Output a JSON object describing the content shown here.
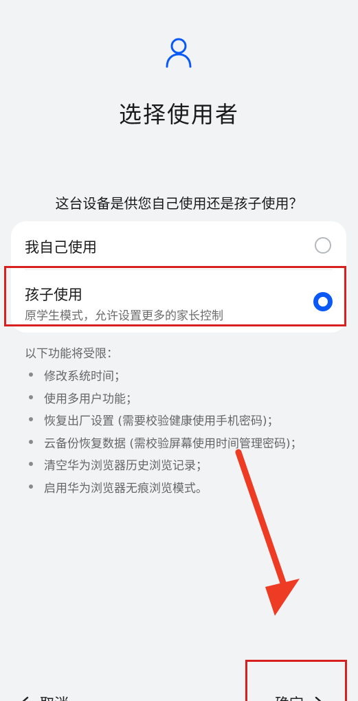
{
  "header": {
    "icon": "user-icon",
    "title": "选择使用者"
  },
  "question": "这台设备是供您自己使用还是孩子使用？",
  "options": {
    "self": {
      "label": "我自己使用",
      "selected": false
    },
    "child": {
      "label": "孩子使用",
      "description": "原学生模式，允许设置更多的家长控制",
      "selected": true
    }
  },
  "restrictions": {
    "title": "以下功能将受限：",
    "items": [
      "修改系统时间；",
      "使用多用户功能；",
      "恢复出厂设置 (需要校验健康使用手机密码)；",
      "云备份恢复数据 (需校验屏幕使用时间管理密码)；",
      "清空华为浏览器历史浏览记录；",
      "启用华为浏览器无痕浏览模式。"
    ]
  },
  "footer": {
    "cancel_label": "取消",
    "confirm_label": "确定"
  },
  "colors": {
    "accent": "#0a59f7",
    "annotation": "#d92020",
    "background": "#f1f3f5"
  }
}
